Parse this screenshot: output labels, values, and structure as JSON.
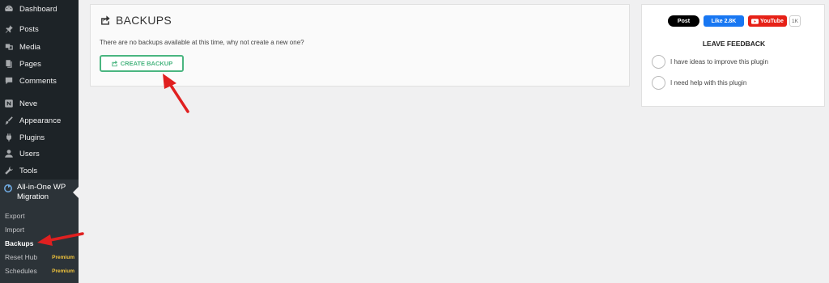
{
  "sidebar": {
    "items": [
      {
        "label": "Dashboard",
        "icon": "dashboard-icon"
      },
      {
        "label": "Posts",
        "icon": "pushpin-icon"
      },
      {
        "label": "Media",
        "icon": "media-icon"
      },
      {
        "label": "Pages",
        "icon": "pages-icon"
      },
      {
        "label": "Comments",
        "icon": "comment-icon"
      },
      {
        "label": "Neve",
        "icon": "neve-logo-icon"
      },
      {
        "label": "Appearance",
        "icon": "paintbrush-icon"
      },
      {
        "label": "Plugins",
        "icon": "plugin-icon"
      },
      {
        "label": "Users",
        "icon": "user-icon"
      },
      {
        "label": "Tools",
        "icon": "wrench-icon"
      }
    ],
    "active": {
      "label": "All-in-One WP Migration",
      "icon": "migration-icon"
    },
    "submenu": [
      {
        "label": "Export",
        "badge": ""
      },
      {
        "label": "Import",
        "badge": ""
      },
      {
        "label": "Backups",
        "badge": ""
      },
      {
        "label": "Reset Hub",
        "badge": "Premium"
      },
      {
        "label": "Schedules",
        "badge": "Premium"
      }
    ]
  },
  "main": {
    "title": "BACKUPS",
    "message": "There are no backups available at this time, why not create a new one?",
    "create_button": "CREATE BACKUP"
  },
  "social": {
    "x_post": "Post",
    "fb_like": "Like 2.8K",
    "youtube": "YouTube",
    "youtube_count": "1K"
  },
  "feedback": {
    "title": "LEAVE FEEDBACK",
    "options": [
      "I have ideas to improve this plugin",
      "I need help with this plugin"
    ]
  },
  "colors": {
    "sidebar_bg": "#1d2327",
    "accent_green": "#4ab580",
    "annotation_red": "#e02020",
    "premium_yellow": "#f0c33c"
  }
}
